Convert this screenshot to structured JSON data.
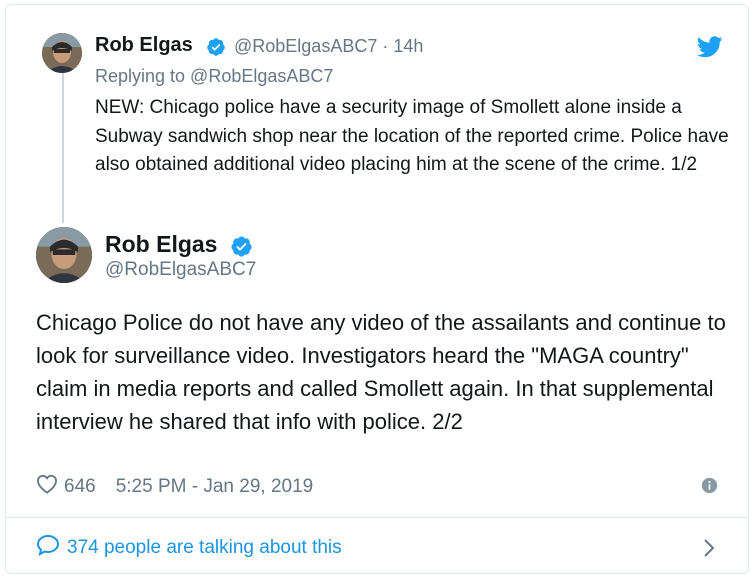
{
  "colors": {
    "brand_blue": "#1da1f2",
    "link_blue": "#1b95e0",
    "secondary_text": "#657786",
    "border": "#e1e8ed"
  },
  "tweet1": {
    "author_name": "Rob Elgas",
    "handle_time": "@RobElgasABC7 · 14h",
    "replying_label": "Replying to @RobElgasABC7",
    "text": "NEW: Chicago police have a security image of Smollett alone inside a Subway sandwich shop near the location of the reported crime. Police have also obtained additional video placing him at the scene of the crime. 1/2"
  },
  "tweet2": {
    "author_name": "Rob Elgas",
    "handle": "@RobElgasABC7",
    "text": "Chicago Police do not have any video of the assailants and continue to look for surveillance video. Investigators heard the \"MAGA country\" claim in media reports and called Smollett again. In that supplemental interview he shared that info with police. 2/2",
    "likes": "646",
    "timestamp": "5:25 PM - Jan 29, 2019"
  },
  "footer": {
    "talking_text": "374 people are talking about this"
  },
  "icons": [
    "twitter-bird-icon",
    "verified-badge-icon",
    "heart-icon",
    "info-icon",
    "speech-bubble-icon",
    "chevron-right-icon"
  ]
}
